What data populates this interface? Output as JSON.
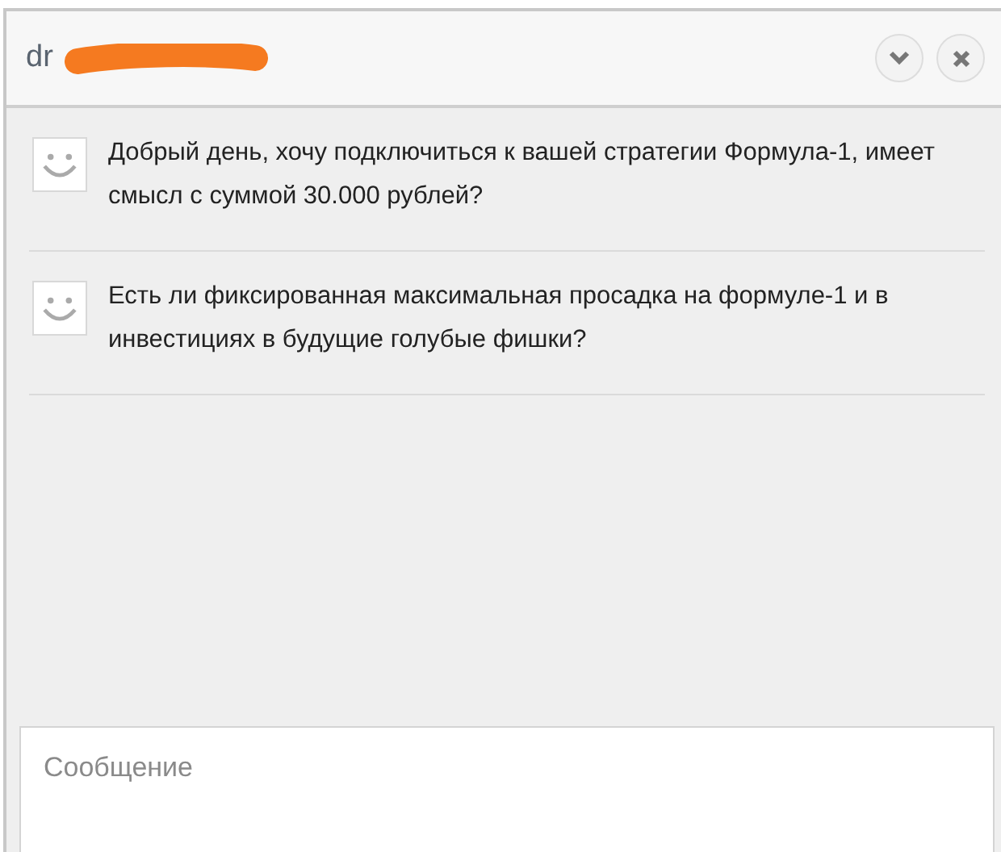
{
  "window": {
    "title": "dr"
  },
  "messages": [
    {
      "text": "Добрый день, хочу подключиться к вашей стратегии Формула-1, имеет смысл с суммой 30.000 рублей?"
    },
    {
      "text": "Есть ли фиксированная максимальная просадка на формуле-1 и в инвестициях в будущие голубые фишки?"
    }
  ],
  "composer": {
    "placeholder": "Сообщение"
  }
}
